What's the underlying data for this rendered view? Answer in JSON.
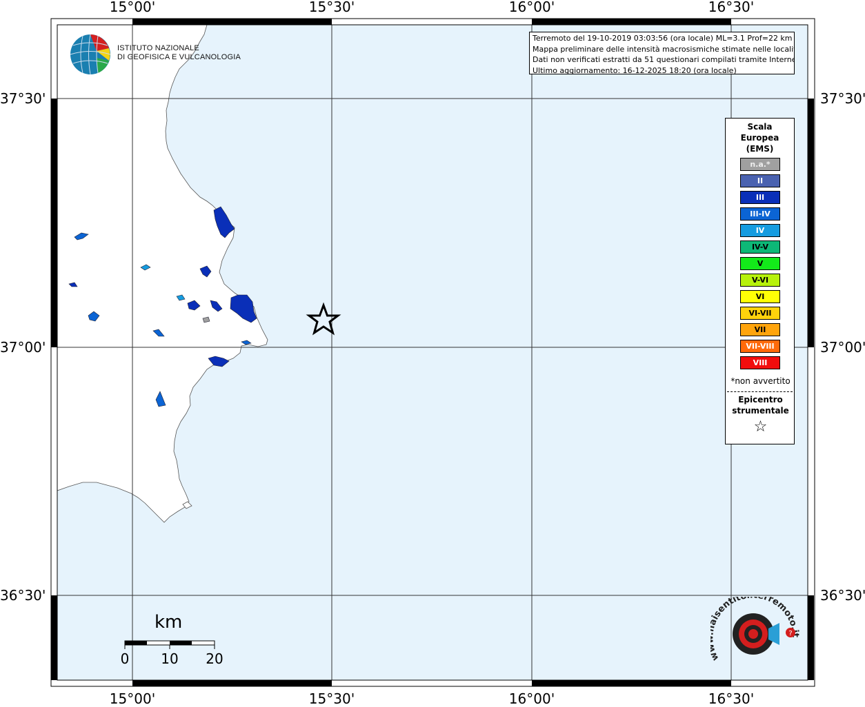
{
  "map": {
    "lon_ticks": [
      "15°00'",
      "15°30'",
      "16°00'",
      "16°30'"
    ],
    "lat_ticks": [
      "37°30'",
      "37°00'",
      "36°30'"
    ],
    "colors": {
      "sea": "#e6f3fc",
      "land": "#ffffff",
      "frame": "#000000"
    }
  },
  "info_box": {
    "line1": "Terremoto del 19-10-2019 03:03:56 (ora locale) ML=3.1 Prof=22 km",
    "line2": "Mappa preliminare delle intensità macrosismiche stimate nelle località",
    "line3": "Dati non verificati estratti da 51 questionari compilati tramite Internet.",
    "line4": "Ultimo aggiornamento: 16-12-2025 18:20 (ora locale)"
  },
  "legend": {
    "title_line1": "Scala",
    "title_line2": "Europea",
    "title_line3": "(EMS)",
    "items": [
      {
        "label": "n.a.*",
        "color": "#a0a0a0"
      },
      {
        "label": "II",
        "color": "#4a62b0"
      },
      {
        "label": "III",
        "color": "#0a2fb8"
      },
      {
        "label": "III-IV",
        "color": "#0b64d4"
      },
      {
        "label": "IV",
        "color": "#159ce0"
      },
      {
        "label": "IV-V",
        "color": "#0db877"
      },
      {
        "label": "V",
        "color": "#13ea1a"
      },
      {
        "label": "V-VI",
        "color": "#b7f20c"
      },
      {
        "label": "VI",
        "color": "#ffff06"
      },
      {
        "label": "VI-VII",
        "color": "#ffd30c"
      },
      {
        "label": "VII",
        "color": "#ffa40c"
      },
      {
        "label": "VII-VIII",
        "color": "#ff6a0a"
      },
      {
        "label": "VIII",
        "color": "#f20d0d"
      }
    ],
    "note": "*non avvertito",
    "epicenter_line1": "Epicentro",
    "epicenter_line2": "strumentale",
    "epicenter_symbol": "☆"
  },
  "logo": {
    "ingv_line1": "ISTITUTO NAZIONALE",
    "ingv_line2": "DI GEOFISICA E VULCANOLOGIA",
    "hsi_text": "www.haisentitoilterremoto.it",
    "hsi_icon": "megaphone-target-icon"
  },
  "scalebar": {
    "unit": "km",
    "labels": [
      "0",
      "10",
      "20"
    ]
  }
}
